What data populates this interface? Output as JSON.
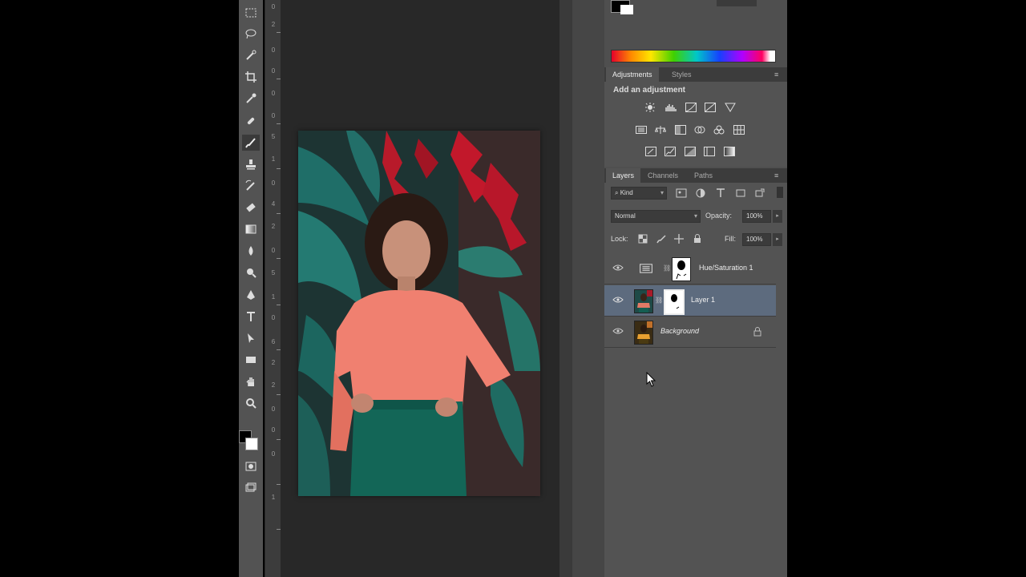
{
  "adjustments_panel": {
    "tabs": [
      "Adjustments",
      "Styles"
    ],
    "heading": "Add an adjustment",
    "icons": [
      "brightness-contrast-icon",
      "levels-icon",
      "curves-icon",
      "exposure-icon",
      "vibrance-icon",
      "hue-saturation-icon",
      "color-balance-icon",
      "black-white-icon",
      "photo-filter-icon",
      "channel-mixer-icon",
      "color-lookup-icon",
      "invert-icon",
      "posterize-icon",
      "threshold-icon",
      "selective-color-icon",
      "gradient-map-icon"
    ]
  },
  "layers_panel": {
    "tabs": [
      "Layers",
      "Channels",
      "Paths"
    ],
    "filter_kind": "Kind",
    "blend_mode": "Normal",
    "opacity_label": "Opacity:",
    "opacity_value": "100%",
    "lock_label": "Lock:",
    "fill_label": "Fill:",
    "fill_value": "100%",
    "layers": [
      {
        "name": "Hue/Saturation 1",
        "type": "adjustment"
      },
      {
        "name": "Layer 1",
        "type": "pixel",
        "selected": true
      },
      {
        "name": "Background",
        "type": "background",
        "locked": true
      }
    ]
  },
  "ruler": {
    "ticks": [
      "0",
      "2",
      "0",
      "0",
      "0",
      "0",
      "5",
      "1",
      "0",
      "4",
      "2",
      "0",
      "5",
      "1",
      "0",
      "6",
      "2",
      "2",
      "0",
      "0",
      "0",
      "1"
    ]
  },
  "colors": {
    "foreground": "#000000",
    "background": "#ffffff",
    "selected_layer": "#5d6b7e",
    "panel": "#4f4f4f"
  }
}
